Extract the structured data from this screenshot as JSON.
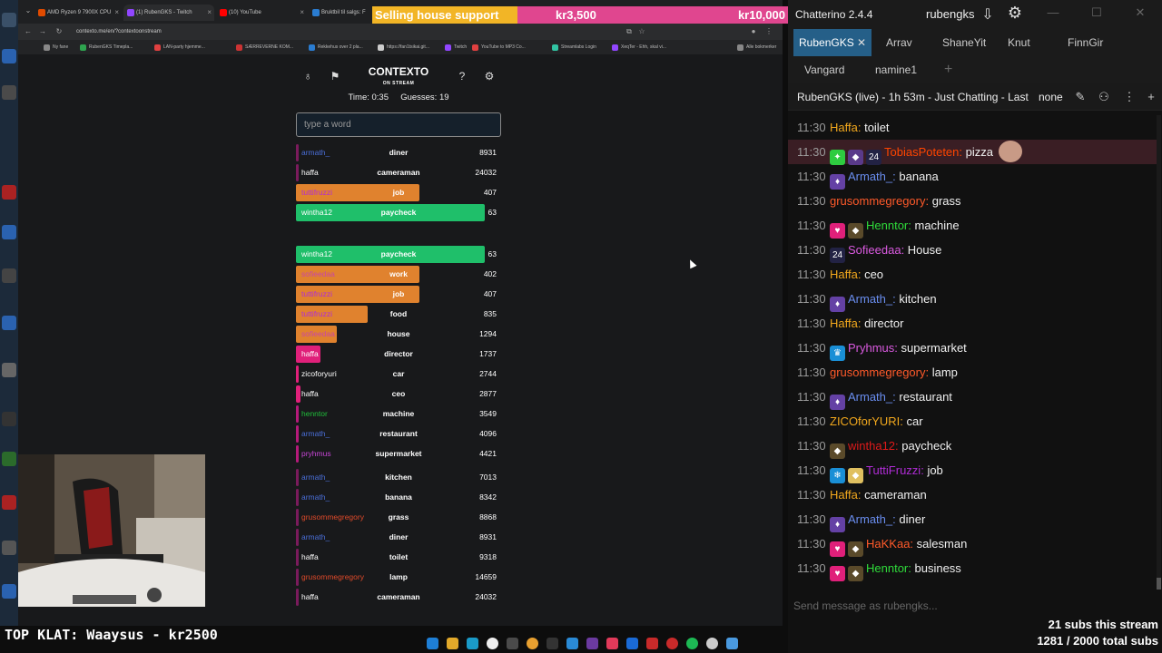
{
  "browser": {
    "tabs": [
      {
        "label": "AMD Ryzen 9 7900X CPU",
        "color": "#e14b00"
      },
      {
        "label": "(1) RubenGKS - Twitch",
        "color": "#9146ff"
      },
      {
        "label": "(10) YouTube",
        "color": "#ff0000"
      },
      {
        "label": "Bruktbil til salgs: F",
        "color": "#2a7cd1"
      }
    ],
    "url": "contexto.me/en/?contextoonstream",
    "bookmarks": [
      {
        "label": "Ny fane",
        "color": "#888888"
      },
      {
        "label": "RubenGKS Timepla...",
        "color": "#2ea44f"
      },
      {
        "label": "LAN-party hjemme...",
        "color": "#e04040"
      },
      {
        "label": "SÆRREVERNE KOM...",
        "color": "#cc3333"
      },
      {
        "label": "Rekkehus over 2 pla...",
        "color": "#2a7cd1"
      },
      {
        "label": "https://fan1tsikai.git...",
        "color": "#cccccc"
      },
      {
        "label": "Twitch",
        "color": "#9146ff"
      },
      {
        "label": "YouTube to MP3 Co...",
        "color": "#e04040"
      },
      {
        "label": "Streamlabs Login",
        "color": "#31c3a2"
      },
      {
        "label": "XeqTer - Ehh, skal vi...",
        "color": "#9146ff"
      },
      {
        "label": "Alle bokmerker",
        "color": "#888888"
      }
    ]
  },
  "support": {
    "label": "Selling house support",
    "current": "kr3,500",
    "goal": "kr10,000"
  },
  "contexto": {
    "title": "CONTEXTO",
    "subtitle": "ON STREAM",
    "stats": "Time: 0:35     Guesses: 19",
    "placeholder": "type a word",
    "latest": [
      {
        "user": "armath_",
        "word": "diner",
        "dist": "8931",
        "userColor": "#4a6fd9",
        "barColor": "#7a1b5c",
        "fill": 0.01
      },
      {
        "user": "haffa",
        "word": "cameraman",
        "dist": "24032",
        "userColor": "#ffffff",
        "barColor": "#7a1b5c",
        "fill": 0.01
      },
      {
        "user": "tuttifruzzi",
        "word": "job",
        "dist": "407",
        "userColor": "#b02cd6",
        "barColor": "#e0822e",
        "fill": 0.6
      },
      {
        "user": "wintha12",
        "word": "paycheck",
        "dist": "63",
        "userColor": "#ffffff",
        "barColor": "#1fbf6a",
        "fill": 0.92
      }
    ],
    "guesses": [
      {
        "user": "wintha12",
        "word": "paycheck",
        "dist": "63",
        "userColor": "#ffffff",
        "barColor": "#1fbf6a",
        "fill": 0.92
      },
      {
        "user": "sofieedaa",
        "word": "work",
        "dist": "402",
        "userColor": "#c745a8",
        "barColor": "#e0822e",
        "fill": 0.6
      },
      {
        "user": "tuttifruzzi",
        "word": "job",
        "dist": "407",
        "userColor": "#b02cd6",
        "barColor": "#e0822e",
        "fill": 0.6
      },
      {
        "user": "tuttifruzzi",
        "word": "food",
        "dist": "835",
        "userColor": "#b02cd6",
        "barColor": "#e0822e",
        "fill": 0.35
      },
      {
        "user": "sofieedaa",
        "word": "house",
        "dist": "1294",
        "userColor": "#c745a8",
        "barColor": "#e0822e",
        "fill": 0.2
      },
      {
        "user": "haffa",
        "word": "director",
        "dist": "1737",
        "userColor": "#ffffff",
        "barColor": "#e0207a",
        "fill": 0.12
      },
      {
        "user": "zicoforyuri",
        "word": "car",
        "dist": "2744",
        "userColor": "#ffffff",
        "barColor": "#e0207a",
        "fill": 0.01
      },
      {
        "user": "haffa",
        "word": "ceo",
        "dist": "2877",
        "userColor": "#ffffff",
        "barColor": "#e0207a",
        "fill": 0.02
      },
      {
        "user": "henntor",
        "word": "machine",
        "dist": "3549",
        "userColor": "#1fbf3a",
        "barColor": "#b51a7a",
        "fill": 0.01
      },
      {
        "user": "armath_",
        "word": "restaurant",
        "dist": "4096",
        "userColor": "#4a6fd9",
        "barColor": "#b51a7a",
        "fill": 0.01
      },
      {
        "user": "pryhmus",
        "word": "supermarket",
        "dist": "4421",
        "userColor": "#c745d6",
        "barColor": "#b51a7a",
        "fill": 0.01
      },
      {
        "user": "armath_",
        "word": "kitchen",
        "dist": "7013",
        "userColor": "#4a6fd9",
        "barColor": "#7a1b5c",
        "fill": 0.01
      },
      {
        "user": "armath_",
        "word": "banana",
        "dist": "8342",
        "userColor": "#4a6fd9",
        "barColor": "#7a1b5c",
        "fill": 0.01
      },
      {
        "user": "grusommegregory",
        "word": "grass",
        "dist": "8868",
        "userColor": "#e04a2a",
        "barColor": "#7a1b5c",
        "fill": 0.01
      },
      {
        "user": "armath_",
        "word": "diner",
        "dist": "8931",
        "userColor": "#4a6fd9",
        "barColor": "#7a1b5c",
        "fill": 0.01
      },
      {
        "user": "haffa",
        "word": "toilet",
        "dist": "9318",
        "userColor": "#ffffff",
        "barColor": "#7a1b5c",
        "fill": 0.01
      },
      {
        "user": "grusommegregory",
        "word": "lamp",
        "dist": "14659",
        "userColor": "#e04a2a",
        "barColor": "#7a1b5c",
        "fill": 0.01
      },
      {
        "user": "haffa",
        "word": "cameraman",
        "dist": "24032",
        "userColor": "#ffffff",
        "barColor": "#7a1b5c",
        "fill": 0.01
      }
    ]
  },
  "overlay": {
    "top_klat": "TOP KLAT: Waaysus - kr2500"
  },
  "chat": {
    "app_name": "Chatterino 2.4.4",
    "user": "rubengks",
    "tabs_row1": [
      "RubenGKS",
      "Arrav",
      "ShaneYit",
      "Knut",
      "FinnGir"
    ],
    "tabs_row2": [
      "Vangard",
      "namine1"
    ],
    "channel_title": "RubenGKS (live) - 1h 53m - Just Chatting - Last",
    "channel_mode": "none",
    "input_placeholder": "Send message as rubengks...",
    "subs_stream": "21 subs this stream",
    "subs_total": "1281 / 2000 total subs",
    "messages": [
      {
        "time": "11:30",
        "user": "Haffa",
        "text": "toilet",
        "color": "#f2a81d",
        "badges": []
      },
      {
        "time": "11:30",
        "user": "TobiasPoteten",
        "text": "pizza",
        "color": "#ff4500",
        "badges": [
          {
            "color": "#2ecc40",
            "icon": "sword-icon"
          },
          {
            "color": "#5a3a8a",
            "icon": "bits-icon"
          },
          {
            "color": "#222244",
            "icon": "sub-24-icon"
          }
        ],
        "highlight": true
      },
      {
        "time": "11:30",
        "user": "Armath_",
        "text": "banana",
        "color": "#6a8ef0",
        "badges": [
          {
            "color": "#6441a5",
            "icon": "prime-icon"
          }
        ]
      },
      {
        "time": "11:30",
        "user": "grusommegregory",
        "text": "grass",
        "color": "#ff5a2a",
        "badges": []
      },
      {
        "time": "11:30",
        "user": "Henntor",
        "text": "machine",
        "color": "#2fdb3a",
        "badges": [
          {
            "color": "#e0207a",
            "icon": "heart-icon"
          },
          {
            "color": "#5a4a2a",
            "icon": "bits-icon"
          }
        ]
      },
      {
        "time": "11:30",
        "user": "Sofieedaa",
        "text": "House",
        "color": "#da5ae0",
        "badges": [
          {
            "color": "#222244",
            "icon": "sub-24-icon"
          }
        ]
      },
      {
        "time": "11:30",
        "user": "Haffa",
        "text": "ceo",
        "color": "#f2a81d",
        "badges": []
      },
      {
        "time": "11:30",
        "user": "Armath_",
        "text": "kitchen",
        "color": "#6a8ef0",
        "badges": [
          {
            "color": "#6441a5",
            "icon": "prime-icon"
          }
        ]
      },
      {
        "time": "11:30",
        "user": "Haffa",
        "text": "director",
        "color": "#f2a81d",
        "badges": []
      },
      {
        "time": "11:30",
        "user": "Pryhmus",
        "text": "supermarket",
        "color": "#da5ae0",
        "badges": [
          {
            "color": "#1a8fd6",
            "icon": "crown-icon"
          }
        ]
      },
      {
        "time": "11:30",
        "user": "grusommegregory",
        "text": "lamp",
        "color": "#ff5a2a",
        "badges": []
      },
      {
        "time": "11:30",
        "user": "Armath_",
        "text": "restaurant",
        "color": "#6a8ef0",
        "badges": [
          {
            "color": "#6441a5",
            "icon": "prime-icon"
          }
        ]
      },
      {
        "time": "11:30",
        "user": "ZICOforYURI",
        "text": "car",
        "color": "#f2a81d",
        "badges": []
      },
      {
        "time": "11:30",
        "user": "wintha12",
        "text": "paycheck",
        "color": "#e01a1a",
        "badges": [
          {
            "color": "#5a4a2a",
            "icon": "bits-icon"
          }
        ]
      },
      {
        "time": "11:30",
        "user": "TuttiFruzzi",
        "text": "job",
        "color": "#b02cd6",
        "badges": [
          {
            "color": "#1a8fd6",
            "icon": "snowflake-icon"
          },
          {
            "color": "#e0c060",
            "icon": "bits-icon"
          }
        ]
      },
      {
        "time": "11:30",
        "user": "Haffa",
        "text": "cameraman",
        "color": "#f2a81d",
        "badges": []
      },
      {
        "time": "11:30",
        "user": "Armath_",
        "text": "diner",
        "color": "#6a8ef0",
        "badges": [
          {
            "color": "#6441a5",
            "icon": "prime-icon"
          }
        ]
      },
      {
        "time": "11:30",
        "user": "HaKKaa",
        "text": "salesman",
        "color": "#ff5a2a",
        "badges": [
          {
            "color": "#e0207a",
            "icon": "heart-icon"
          },
          {
            "color": "#5a4a2a",
            "icon": "bits-icon"
          }
        ]
      },
      {
        "time": "11:30",
        "user": "Henntor",
        "text": "business",
        "color": "#2fdb3a",
        "badges": [
          {
            "color": "#e0207a",
            "icon": "heart-icon"
          },
          {
            "color": "#5a4a2a",
            "icon": "bits-icon"
          }
        ]
      }
    ]
  }
}
